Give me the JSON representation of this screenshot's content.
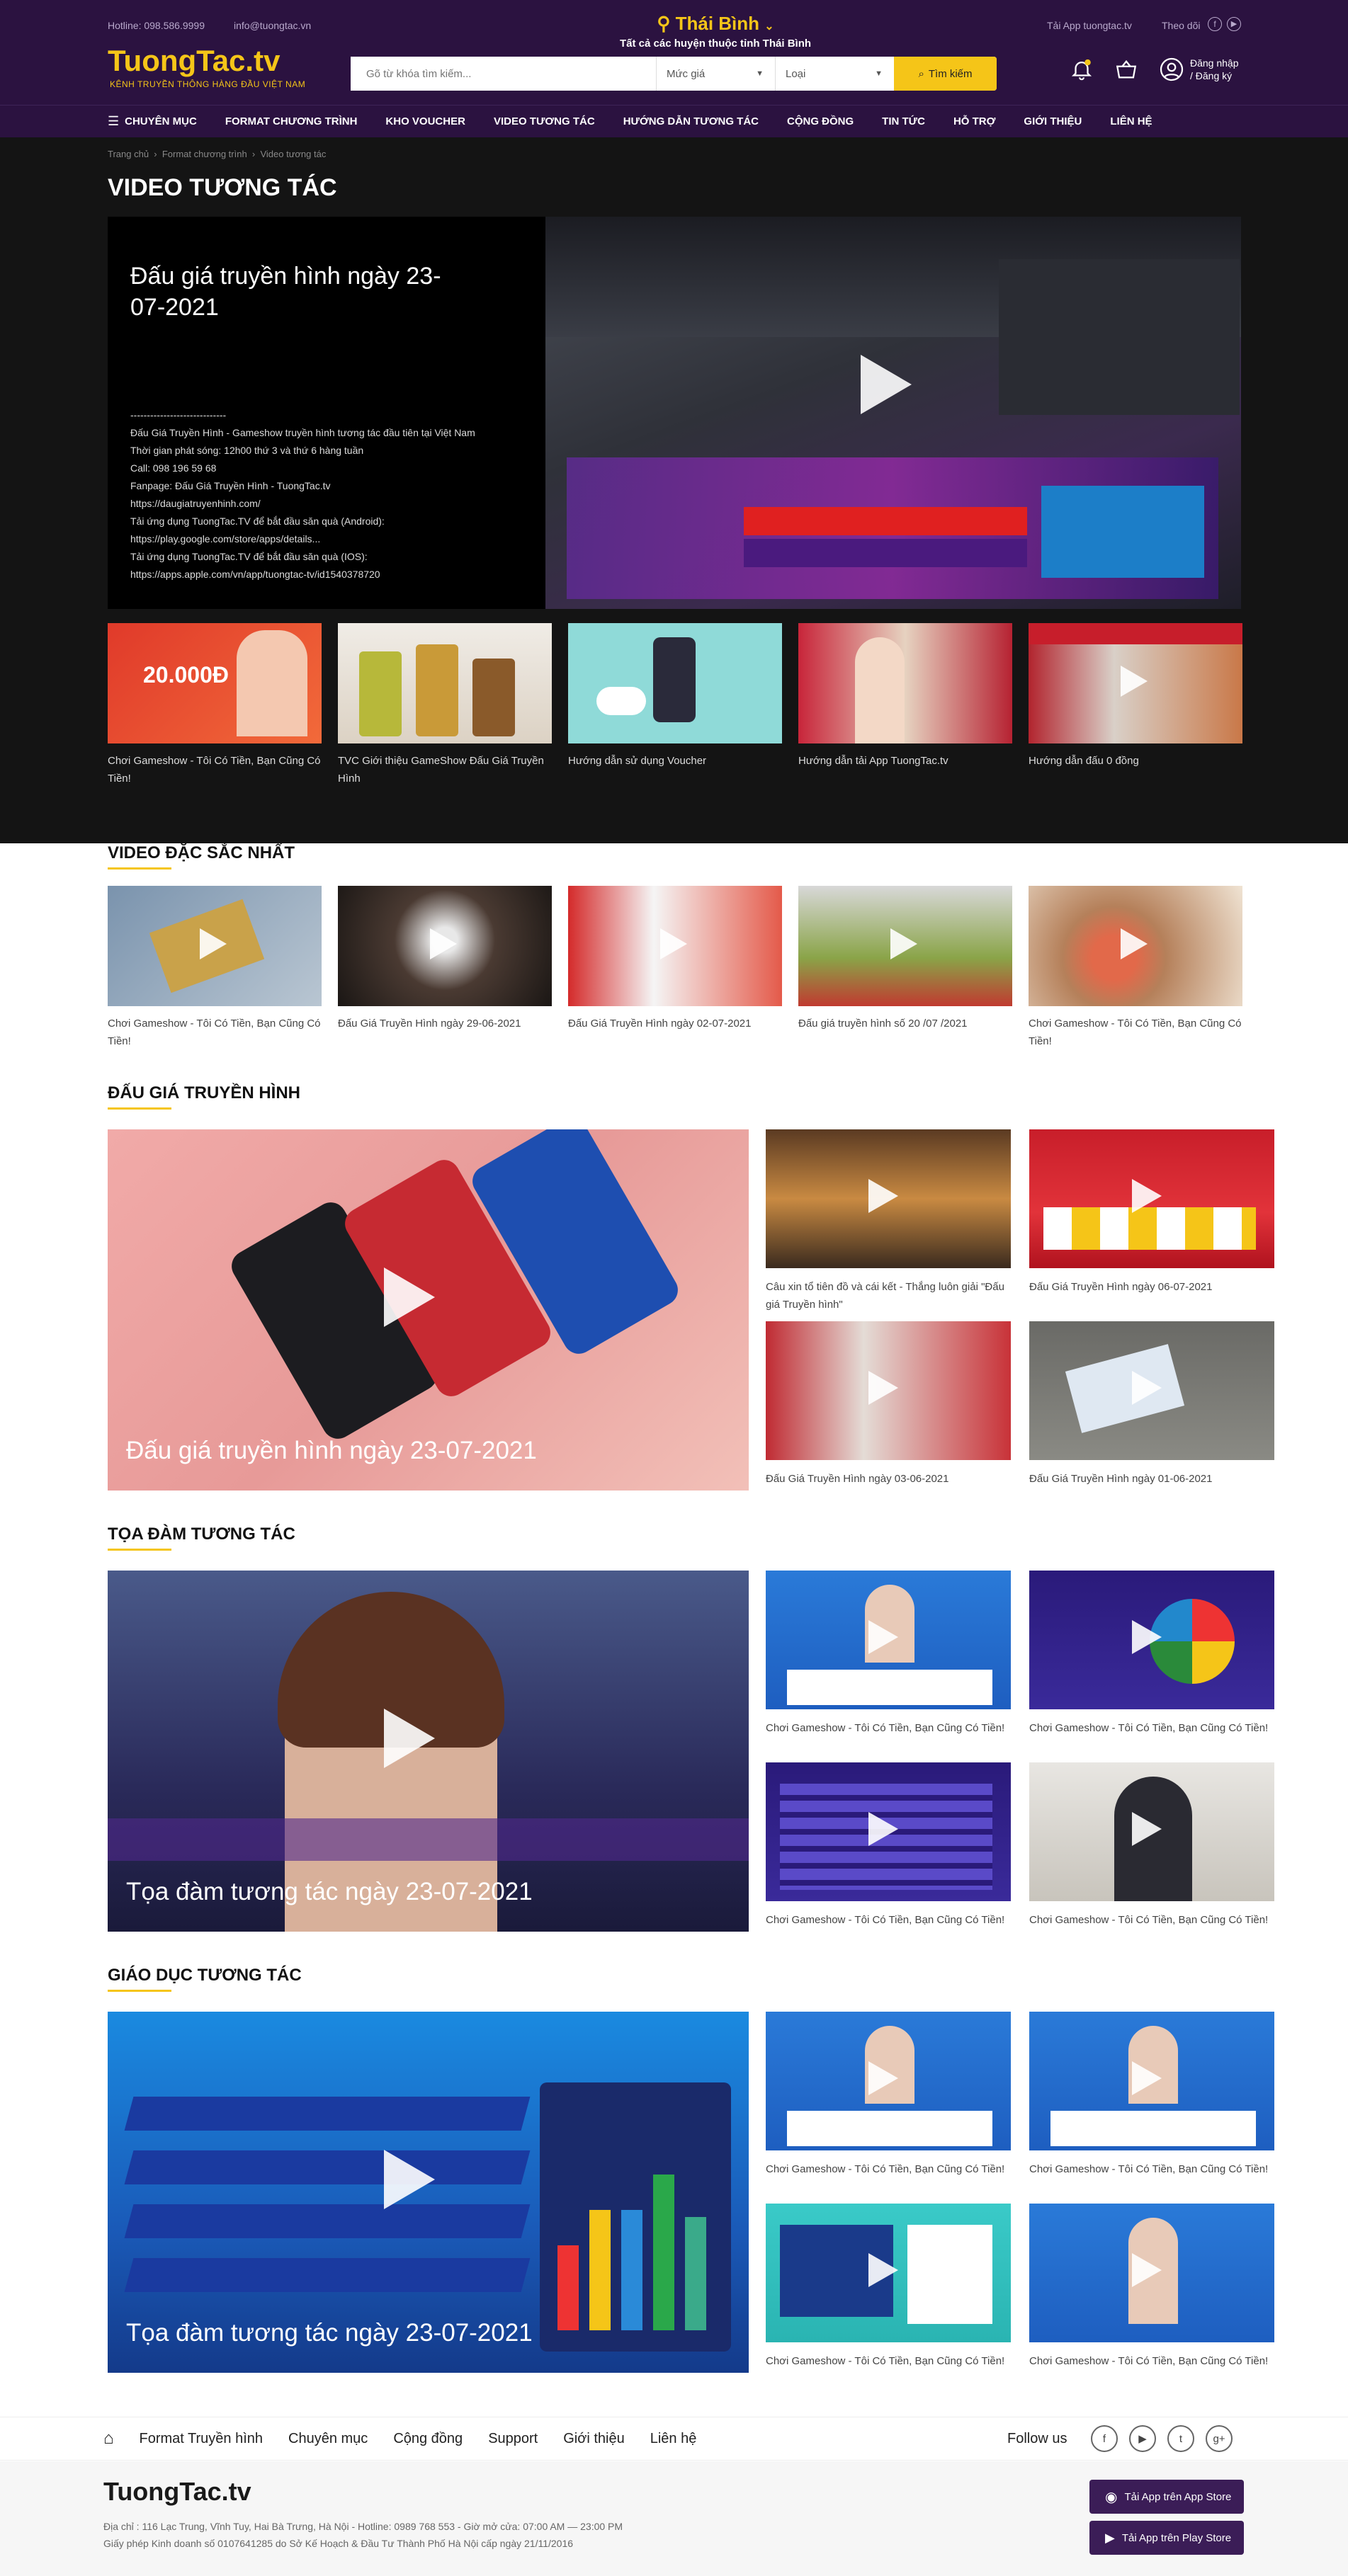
{
  "header": {
    "hotline": "Hotline: 098.586.9999",
    "email": "info@tuongtac.vn",
    "logo": "TuongTac.tv",
    "tagline": "KÊNH TRUYỀN THÔNG HÀNG ĐẦU VIỆT NAM",
    "city": "Thái Bình",
    "city_sub": "Tất cả các huyện thuộc tỉnh Thái Bình",
    "app_label": "Tải App tuongtac.tv",
    "follow_label": "Theo dõi",
    "search_placeholder": "Gõ từ khóa tìm kiếm...",
    "price_select": "Mức giá",
    "type_select": "Loại",
    "search_button": "Tìm kiếm",
    "login_line1": "Đăng nhập",
    "login_line2": "/ Đăng ký"
  },
  "nav": [
    "CHUYÊN MỤC",
    "FORMAT CHƯƠNG TRÌNH",
    "KHO VOUCHER",
    "VIDEO TƯƠNG TÁC",
    "HƯỚNG DẪN TƯƠNG TÁC",
    "CỘNG ĐỒNG",
    "TIN TỨC",
    "HỖ TRỢ",
    "GIỚI THIỆU",
    "LIÊN HỆ"
  ],
  "breadcrumb": [
    "Trang chủ",
    "Format chương trình",
    "Video tương tác"
  ],
  "page_title": "VIDEO TƯƠNG TÁC",
  "hero": {
    "title": "Đấu giá truyền hình ngày 23-07-2021",
    "desc": [
      "-----------------------------",
      "Đấu Giá Truyền Hình - Gameshow truyền hình tương tác đầu tiên tại Việt Nam",
      "Thời gian phát sóng: 12h00 thứ 3 và thứ 6 hàng tuần",
      "Call: 098 196 59 68",
      "Fanpage: Đấu Giá Truyền Hình - TuongTac.tv",
      "https://daugiatruyenhinh.com/",
      "Tải ứng dụng TuongTac.TV để bắt đầu săn quà (Android):",
      "https://play.google.com/store/apps/details...",
      "Tải ứng dụng TuongTac.TV để bắt đầu săn quà (IOS):",
      "https://apps.apple.com/vn/app/tuongtac-tv/id1540378720"
    ]
  },
  "hero_thumbs": [
    "Chơi Gameshow - Tôi Có Tiền, Bạn Cũng Có Tiền!",
    "TVC Giới thiệu GameShow Đấu Giá Truyền Hình",
    "Hướng dẫn sử dụng Voucher",
    "Hướng dẫn tải App TuongTac.tv",
    "Hướng dẫn đấu 0 đồng"
  ],
  "featured": {
    "title": "VIDEO ĐẶC SẮC NHẤT",
    "items": [
      "Chơi Gameshow - Tôi Có Tiền, Bạn Cũng Có Tiền!",
      "Đấu Giá Truyền Hình ngày 29-06-2021",
      "Đấu Giá Truyền Hình ngày 02-07-2021",
      "Đấu giá truyền hình số 20 /07 /2021",
      "Chơi Gameshow - Tôi Có Tiền, Bạn Cũng Có Tiền!"
    ]
  },
  "auction": {
    "title": "ĐẤU GIÁ TRUYỀN HÌNH",
    "big": "Đấu giá truyền hình ngày 23-07-2021",
    "items": [
      "Câu xin tổ tiên đồ và cái kết - Thắng luôn giải \"Đấu giá Truyền hình\"",
      "Đấu Giá Truyền Hình ngày 06-07-2021",
      "Đấu Giá Truyền Hình ngày 03-06-2021",
      "Đấu Giá Truyền Hình ngày 01-06-2021"
    ]
  },
  "talk": {
    "title": "TỌA ĐÀM TƯƠNG TÁC",
    "big": "Tọa đàm tương tác ngày 23-07-2021",
    "items": [
      "Chơi Gameshow - Tôi Có Tiền, Bạn Cũng Có Tiền!",
      "Chơi Gameshow - Tôi Có Tiền, Bạn Cũng Có Tiền!",
      "Chơi Gameshow - Tôi Có Tiền, Bạn Cũng Có Tiền!",
      "Chơi Gameshow - Tôi Có Tiền, Bạn Cũng Có Tiền!"
    ]
  },
  "edu": {
    "title": "GIÁO DỤC TƯƠNG TÁC",
    "big": "Tọa đàm tương tác ngày 23-07-2021",
    "items": [
      "Chơi Gameshow - Tôi Có Tiền, Bạn Cũng Có Tiền!",
      "Chơi Gameshow - Tôi Có Tiền, Bạn Cũng Có Tiền!",
      "Chơi Gameshow - Tôi Có Tiền, Bạn Cũng Có Tiền!",
      "Chơi Gameshow - Tôi Có Tiền, Bạn Cũng Có Tiền!"
    ]
  },
  "footer_nav": [
    "Format Truyền hình",
    "Chuyên mục",
    "Cộng đồng",
    "Support",
    "Giới thiệu",
    "Liên hệ"
  ],
  "follow_us": "Follow us",
  "footer": {
    "logo": "TuongTac.tv",
    "address": "Địa chỉ : 116 Lạc Trung, Vĩnh Tuy, Hai Bà Trưng, Hà Nội - Hotline: 0989 768 553 - Giờ mở cửa: 07:00 AM — 23:00 PM",
    "license": "Giấy phép Kinh doanh số 0107641285 do Sở Kế Hoạch & Đầu Tư Thành Phố Hà Nội cấp ngày 21/11/2016",
    "appstore": "Tải App trên App Store",
    "playstore": "Tải App trên Play Store"
  }
}
